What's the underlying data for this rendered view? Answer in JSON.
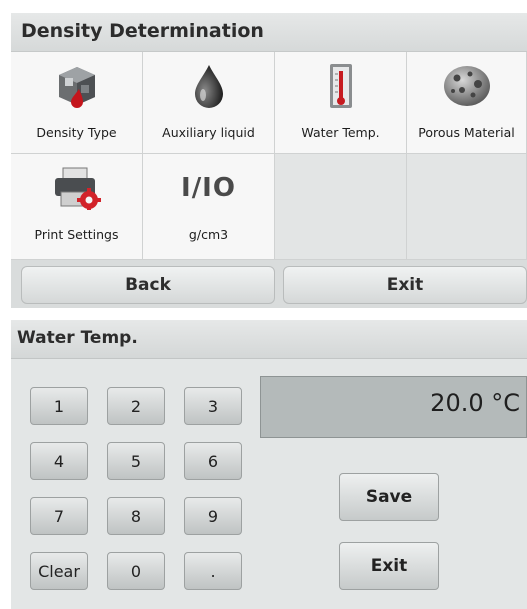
{
  "density_screen": {
    "title": "Density Determination",
    "tiles": [
      {
        "label": "Density Type",
        "icon": "density-cube-icon"
      },
      {
        "label": "Auxiliary liquid",
        "icon": "liquid-drop-icon"
      },
      {
        "label": "Water Temp.",
        "icon": "thermometer-icon"
      },
      {
        "label": "Porous Material",
        "icon": "porous-stone-icon"
      },
      {
        "label": "Print Settings",
        "icon": "printer-gear-icon"
      },
      {
        "label": "g/cm3",
        "icon_text": "I/IO"
      }
    ],
    "back_label": "Back",
    "exit_label": "Exit"
  },
  "water_temp_screen": {
    "title": "Water Temp.",
    "display_value": "20.0 °C",
    "keypad": [
      "1",
      "2",
      "3",
      "4",
      "5",
      "6",
      "7",
      "8",
      "9",
      "Clear",
      "0",
      "."
    ],
    "save_label": "Save",
    "exit_label": "Exit"
  }
}
